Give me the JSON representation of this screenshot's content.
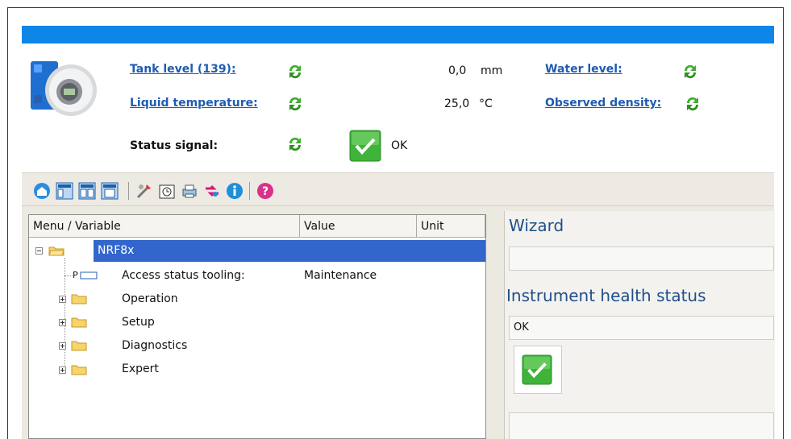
{
  "header": {
    "tank_level_label": "Tank level (139):",
    "tank_level_value": "0,0",
    "tank_level_unit": "mm",
    "liquid_temp_label": "Liquid temperature:",
    "liquid_temp_value": "25,0",
    "liquid_temp_unit": "°C",
    "water_level_label": "Water level:",
    "observed_density_label": "Observed density:",
    "status_signal_label": "Status signal:",
    "status_value": "OK"
  },
  "colors": {
    "accent": "#0d86e8",
    "selection": "#3366cc",
    "link": "#1e5bb3",
    "heading": "#1f4f8a",
    "ok_green": "#3fb33a"
  },
  "toolbar": {
    "buttons": [
      "home-icon",
      "layout-icon",
      "layout-split-icon",
      "window-icon",
      "tools-icon",
      "clock-icon",
      "print-icon",
      "arrows-icon",
      "info-icon",
      "help-icon"
    ]
  },
  "tree": {
    "columns": [
      "Menu / Variable",
      "Value",
      "Unit"
    ],
    "root": "NRF8x",
    "items": [
      {
        "prefix": "P",
        "label": "Access status tooling:",
        "value": "Maintenance"
      },
      {
        "label": "Operation"
      },
      {
        "label": "Setup"
      },
      {
        "label": "Diagnostics"
      },
      {
        "label": "Expert"
      }
    ]
  },
  "right": {
    "wizard_title": "Wizard",
    "health_title": "Instrument health status",
    "health_value": "OK"
  }
}
